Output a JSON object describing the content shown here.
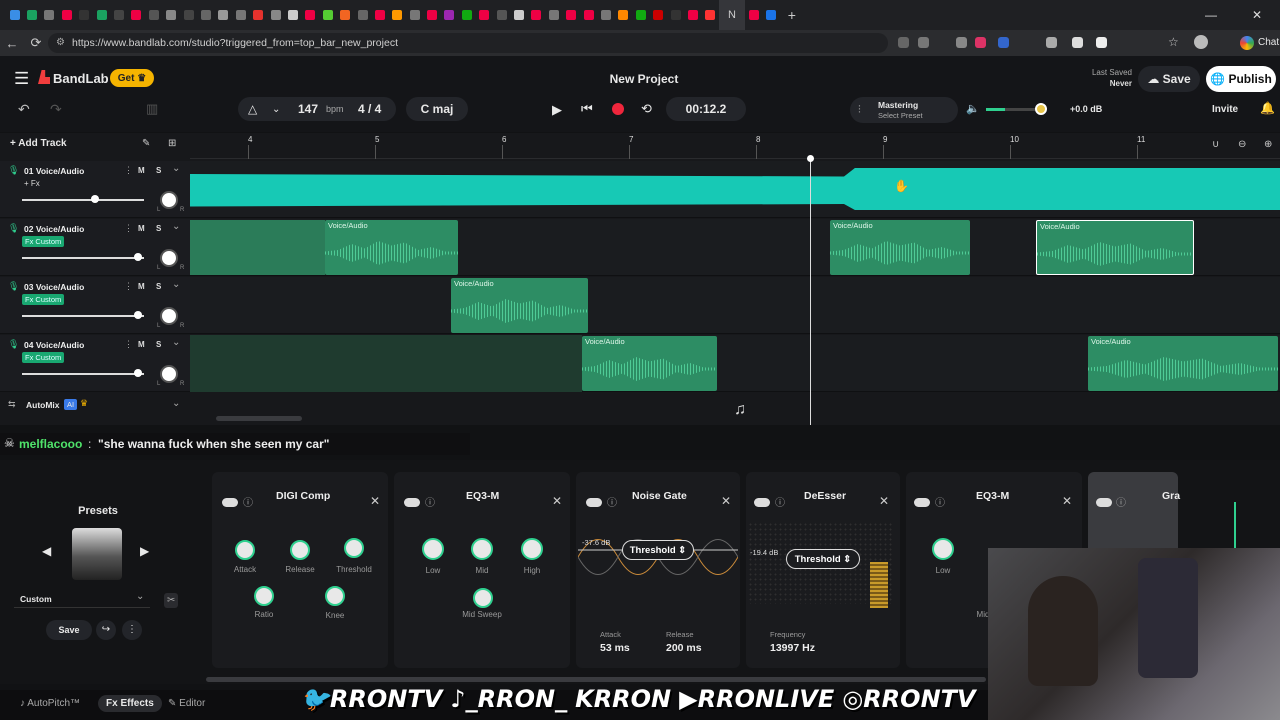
{
  "browser": {
    "url": "https://www.bandlab.com/studio?triggered_from=top_bar_new_project",
    "active_tab_label": "N",
    "profile_chat": "Chat",
    "tab_colors": [
      "#3a8ee6",
      "#1aa260",
      "#777",
      "#e04",
      "#333",
      "#1aa260",
      "#444",
      "#e04",
      "#555",
      "#888",
      "#444",
      "#666",
      "#999",
      "#777",
      "#e5322d",
      "#888",
      "#ccc",
      "#e04",
      "#5c3",
      "#f26522",
      "#666",
      "#e04",
      "#ff9900",
      "#777",
      "#e04",
      "#9c27b0",
      "#1a1",
      "#e04",
      "#555",
      "#ccc",
      "#e04",
      "#777",
      "#e04",
      "#e04",
      "#777",
      "#f80",
      "#1a1",
      "#c00",
      "#333",
      "#e04",
      "#f33",
      "#e04",
      "#1a73e8"
    ]
  },
  "app": {
    "logo": "BandLab",
    "get_label": "Get",
    "project_title": "New Project",
    "last_saved_label": "Last Saved",
    "last_saved_value": "Never",
    "save_label": "Save",
    "publish_label": "Publish",
    "invite_label": "Invite"
  },
  "transport": {
    "bpm_value": "147",
    "bpm_unit": "bpm",
    "time_sig": "4 / 4",
    "key": "C maj",
    "time": "00:12.2",
    "mastering_title": "Mastering",
    "mastering_sub": "Select Preset",
    "volume_db": "+0.0 dB",
    "master_volume_level": 0.38
  },
  "timeline": {
    "add_track_label": "Add Track",
    "ruler": [
      "4",
      "5",
      "6",
      "7",
      "8",
      "9",
      "10",
      "11"
    ]
  },
  "tracks": [
    {
      "name": "01  Voice/Audio",
      "fx": "+ Fx",
      "volume": 0.6
    },
    {
      "name": "02  Voice/Audio",
      "fx": "Fx Custom",
      "volume": 0.95
    },
    {
      "name": "03  Voice/Audio",
      "fx": "Fx Custom",
      "volume": 0.95
    },
    {
      "name": "04  Voice/Audio",
      "fx": "Fx Custom",
      "volume": 0.95
    }
  ],
  "clip_label": "Voice/Audio",
  "automix": {
    "label": "AutoMix",
    "ai": "AI"
  },
  "track_controls": {
    "mute": "M",
    "solo": "S",
    "pan_left": "L",
    "pan_right": "R"
  },
  "chat": {
    "user": "melflacooo",
    "sep": ":",
    "message": "\"she wanna fuck when she seen my car\""
  },
  "presets": {
    "title": "Presets",
    "selected": "Custom",
    "save": "Save"
  },
  "effects": [
    {
      "title": "DIGI Comp",
      "knobs": [
        "Attack",
        "Release",
        "Threshold",
        "Ratio",
        "Knee"
      ]
    },
    {
      "title": "EQ3-M",
      "knobs": [
        "Low",
        "Mid",
        "High",
        "Mid Sweep"
      ]
    },
    {
      "title": "Noise Gate",
      "threshold_label": "Threshold",
      "db": "-37.6 dB",
      "attack_label": "Attack",
      "attack": "53 ms",
      "release_label": "Release",
      "release": "200 ms"
    },
    {
      "title": "DeEsser",
      "threshold_label": "Threshold",
      "db": "-19.4 dB",
      "freq_label": "Frequency",
      "freq": "13997 Hz"
    },
    {
      "title": "EQ3-M",
      "knobs": [
        "Low",
        "Mid"
      ]
    },
    {
      "title": "Gra"
    }
  ],
  "bottom_tabs": {
    "autopitch": "AutoPitch™",
    "effects": "Effects",
    "editor": "Editor"
  },
  "stream_overlay": {
    "twitter": "RRONTV",
    "tiktok": "_RRON_",
    "kick": "RRON",
    "youtube": "RRONLIVE",
    "instagram": "RRONTV"
  }
}
